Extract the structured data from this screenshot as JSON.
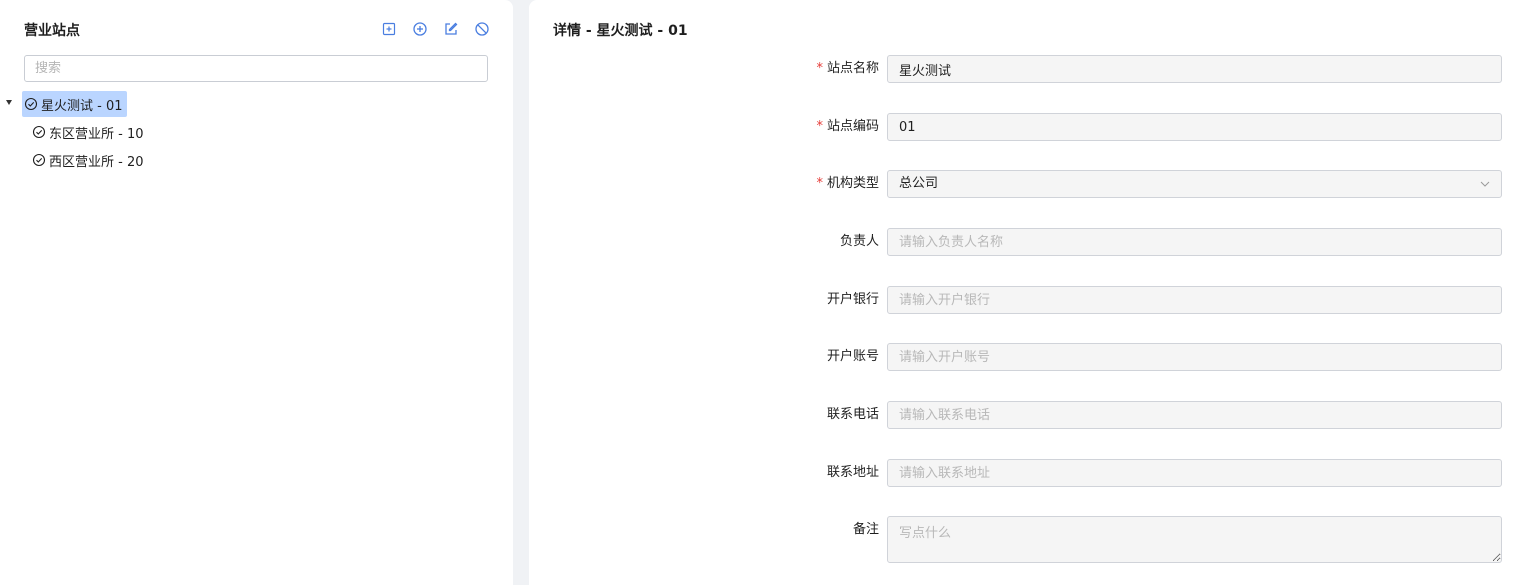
{
  "left_panel": {
    "title": "营业站点",
    "toolbar": [
      {
        "name": "expand-all-icon"
      },
      {
        "name": "add-circle-icon"
      },
      {
        "name": "edit-icon"
      },
      {
        "name": "disable-icon"
      }
    ],
    "search": {
      "placeholder": "搜索",
      "value": ""
    },
    "tree": {
      "root": {
        "label": "星火测试 - 01",
        "selected": true,
        "expanded": true
      },
      "children": [
        {
          "label": "东区营业所 - 10"
        },
        {
          "label": "西区营业所 - 20"
        }
      ]
    }
  },
  "right_panel": {
    "title": "详情 - 星火测试 - 01",
    "form": {
      "station_name": {
        "label": "站点名称",
        "required": true,
        "value": ""
      },
      "station_code": {
        "label": "站点编码",
        "required": true,
        "value": ""
      },
      "org_type": {
        "label": "机构类型",
        "required": true,
        "value": "总公司"
      },
      "manager": {
        "label": "负责人",
        "required": false,
        "value": "",
        "placeholder": "请输入负责人名称"
      },
      "bank": {
        "label": "开户银行",
        "required": false,
        "value": "",
        "placeholder": "请输入开户银行"
      },
      "account": {
        "label": "开户账号",
        "required": false,
        "value": "",
        "placeholder": "请输入开户账号"
      },
      "phone": {
        "label": "联系电话",
        "required": false,
        "value": "",
        "placeholder": "请输入联系电话"
      },
      "address": {
        "label": "联系地址",
        "required": false,
        "value": "",
        "placeholder": "请输入联系地址"
      },
      "remark": {
        "label": "备注",
        "required": false,
        "value": "",
        "placeholder": "写点什么"
      }
    }
  },
  "form_values": {
    "station_name": "星火测试",
    "station_code": "01"
  },
  "required_mark": "*",
  "colors": {
    "accent": "#4a7ee0",
    "selected_bg": "#bad5ff",
    "required": "#e53935",
    "input_bg": "#f5f5f5"
  }
}
